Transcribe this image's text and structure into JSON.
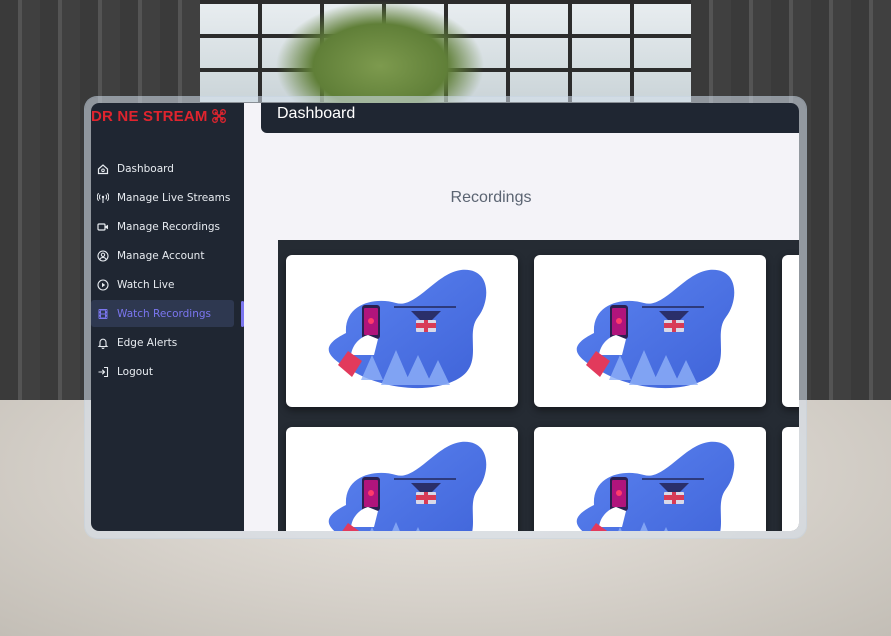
{
  "app": {
    "logo_text": "DR NE STREAM",
    "page_title": "Dashboard",
    "section_title": "Recordings"
  },
  "sidebar": {
    "items": [
      {
        "label": "Dashboard",
        "icon": "home-icon"
      },
      {
        "label": "Manage Live Streams",
        "icon": "broadcast-icon"
      },
      {
        "label": "Manage Recordings",
        "icon": "video-camera-icon"
      },
      {
        "label": "Manage Account",
        "icon": "user-circle-icon"
      },
      {
        "label": "Watch Live",
        "icon": "play-circle-icon"
      },
      {
        "label": "Watch Recordings",
        "icon": "film-icon",
        "active": true
      },
      {
        "label": "Edge Alerts",
        "icon": "bell-icon"
      },
      {
        "label": "Logout",
        "icon": "logout-icon"
      }
    ]
  },
  "recordings": {
    "thumbnail_icon": "drone-phone-illustration",
    "count_visible": 6
  },
  "colors": {
    "sidebar_bg": "#1f2632",
    "accent": "#7b76f0",
    "logo_red": "#e0242e",
    "content_bg": "#f4f3f8",
    "grid_bg": "#252b33"
  }
}
